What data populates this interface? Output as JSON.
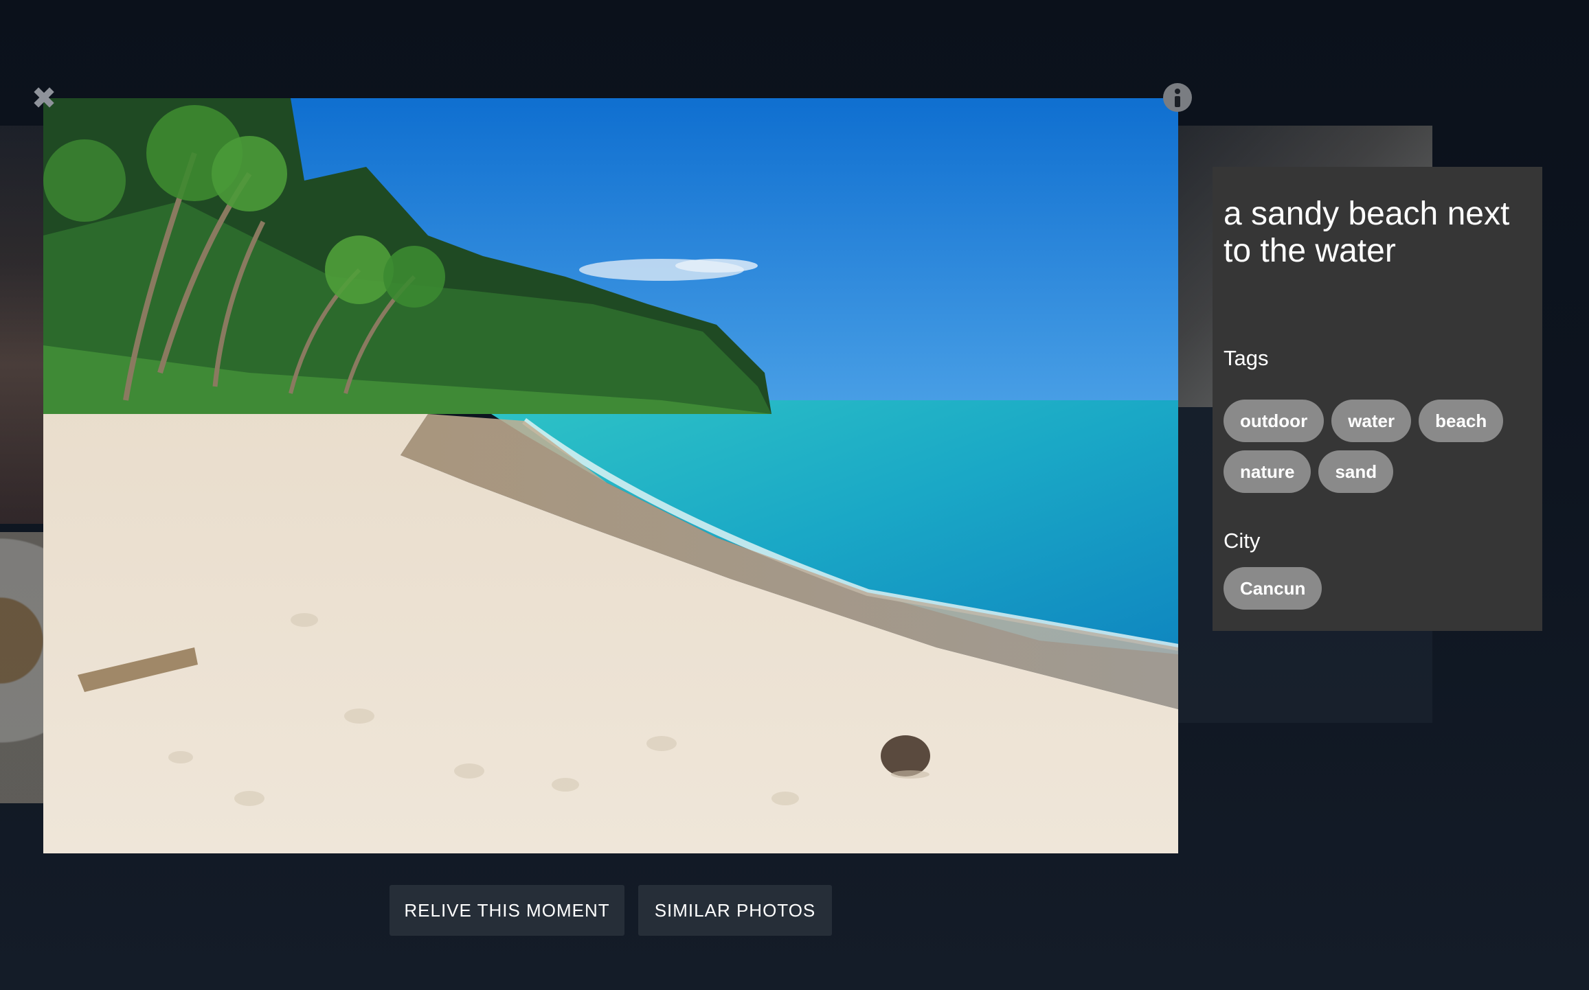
{
  "viewer": {
    "close_icon": "close-icon",
    "info_icon": "info-icon",
    "close_glyph": "✖"
  },
  "photo": {
    "description": "a sandy beach next to the water"
  },
  "info_panel": {
    "caption": "a sandy beach next to the water",
    "tags_label": "Tags",
    "tags": [
      "outdoor",
      "water",
      "beach",
      "nature",
      "sand"
    ],
    "city_label": "City",
    "city": "Cancun"
  },
  "actions": {
    "relive_label": "RELIVE THIS MOMENT",
    "similar_label": "SIMILAR PHOTOS"
  },
  "colors": {
    "background": "#0c121d",
    "panel": "#363636",
    "chip": "#8a8a8a",
    "button": "#262e38"
  }
}
